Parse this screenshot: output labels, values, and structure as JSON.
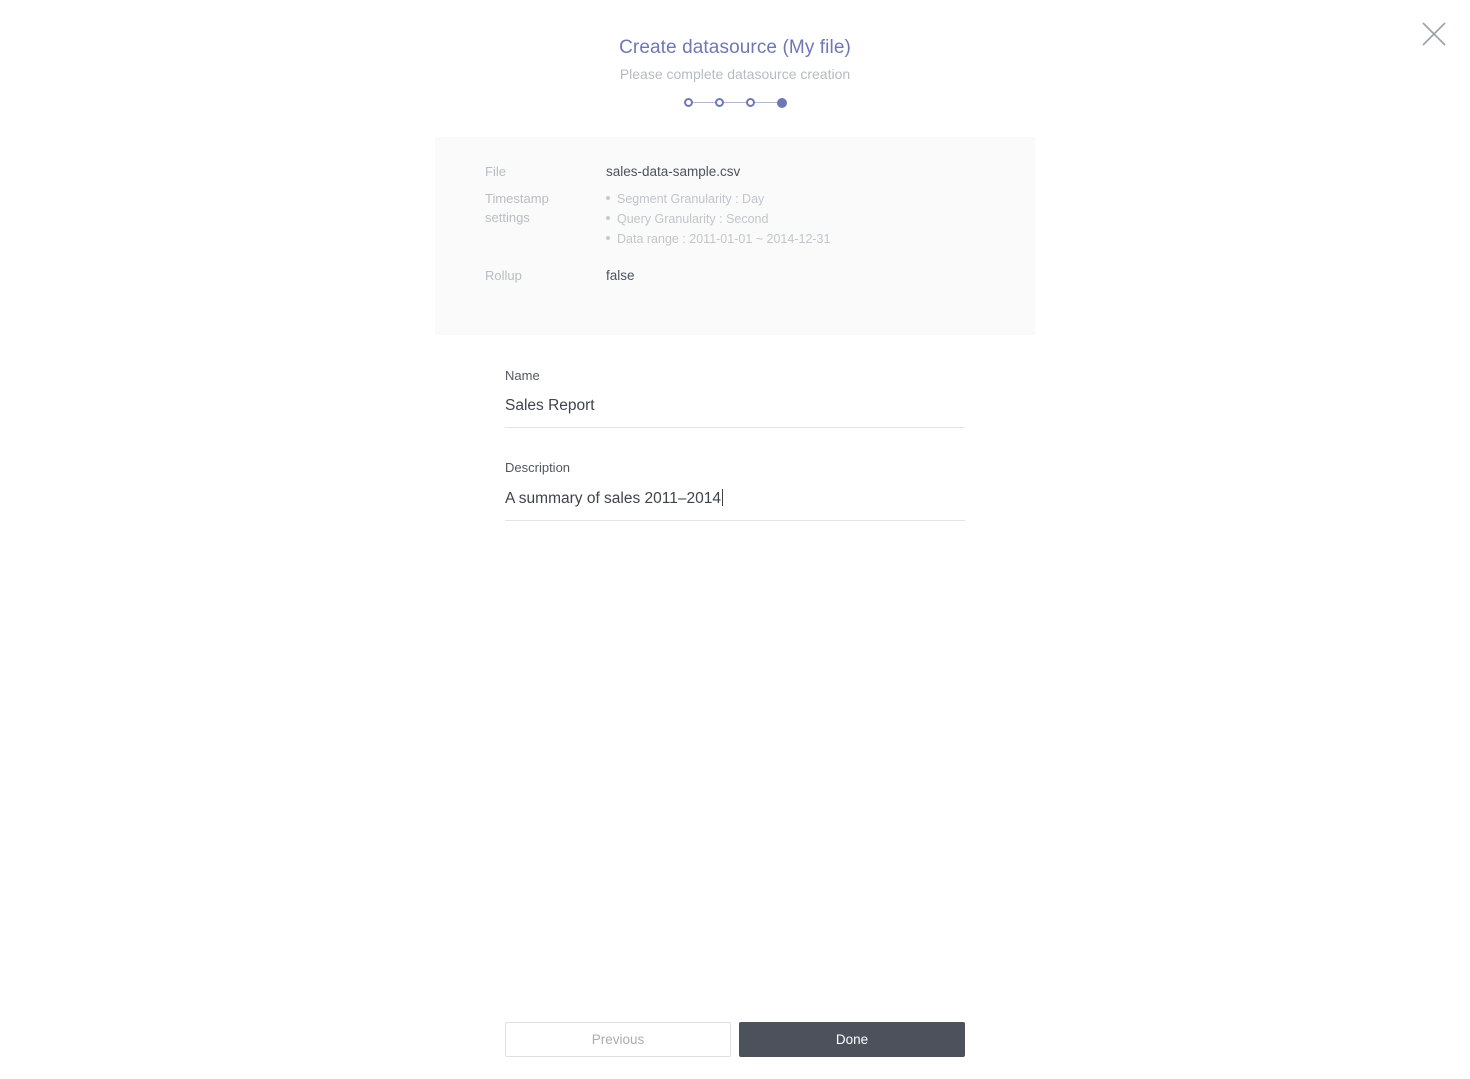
{
  "window": {
    "close_icon": "close-icon"
  },
  "header": {
    "title": "Create datasource (My file)",
    "subtitle": "Please complete datasource creation",
    "accent_color": "#6f77b5",
    "subtitle_color": "#b7bbc3"
  },
  "steps": {
    "total": 4,
    "current": 4,
    "items": [
      {
        "index": 1,
        "state": "inactive"
      },
      {
        "index": 2,
        "state": "inactive"
      },
      {
        "index": 3,
        "state": "inactive"
      },
      {
        "index": 4,
        "state": "active"
      }
    ]
  },
  "summary": {
    "background_color": "#fafafa",
    "rows": [
      {
        "label": "File",
        "value": "sales-data-sample.csv"
      },
      {
        "label": "Timestamp settings",
        "bullets": [
          "Segment Granularity : Day",
          "Query Granularity : Second",
          "Data range : 2011-01-01 ~ 2014-12-31"
        ]
      },
      {
        "label": "Rollup",
        "value": "false"
      }
    ]
  },
  "form": {
    "name": {
      "label": "Name",
      "value": "Sales Report",
      "placeholder": "Name"
    },
    "description": {
      "label": "Description",
      "value": "A summary of sales 2011–2014",
      "placeholder": "Description",
      "focused": true
    }
  },
  "footer": {
    "previous_label": "Previous",
    "done_label": "Done",
    "done_color": "#4c515c"
  }
}
